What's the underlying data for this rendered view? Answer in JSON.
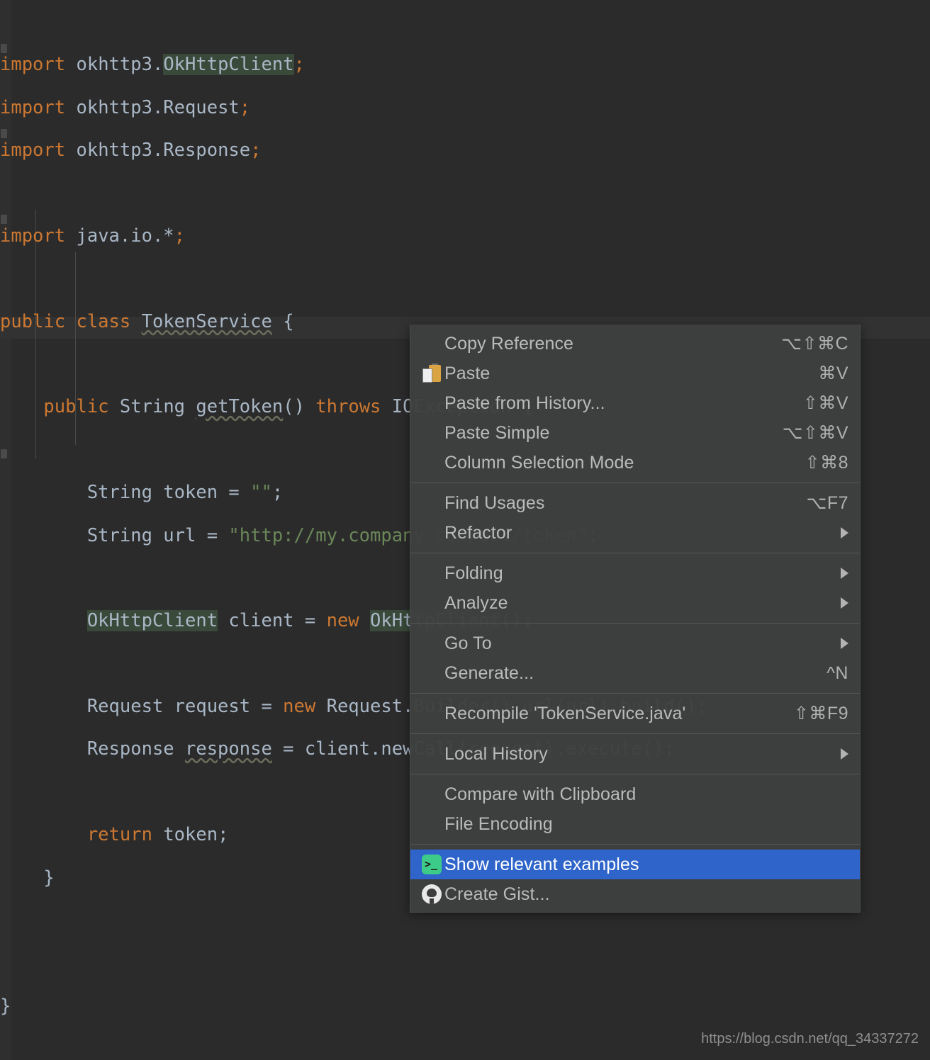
{
  "editor": {
    "background_color": "#2b2b2b",
    "gutter_color": "#2f2f2f",
    "current_line_color": "#323232",
    "usage_highlight_color": "#3a4a3a",
    "code_lines": [
      "import okhttp3.OkHttpClient;",
      "import okhttp3.Request;",
      "import okhttp3.Response;",
      "",
      "import java.io.*;",
      "",
      "public class TokenService {",
      "",
      "    public String getToken() throws IOException {",
      "",
      "        String token = \"\";",
      "        String url = \"http://my.company.com/api/token\";",
      "",
      "        OkHttpClient client = new OkHttpClient();",
      "",
      "        Request request = new Request.Builder().url(url).build();",
      "        Response response = client.newCall(request).execute();",
      "",
      "        return token;",
      "    }",
      "",
      "",
      "}"
    ],
    "class_name": "TokenService",
    "file_name": "TokenService.java",
    "method_name": "getToken",
    "url_literal": "http://my.company.com/api/token",
    "tokens": {
      "import": "import",
      "public": "public",
      "class": "class",
      "new": "new",
      "throws": "throws",
      "return": "return",
      "string_type": "String",
      "okhttp_client": "OkHttpClient",
      "request_type": "Request",
      "response_type": "Response",
      "io_exception": "IOException",
      "empty_string": "\"\"",
      "pkg_okhttp": "okhttp3.",
      "pkg_java_io": "java.io.*;"
    },
    "colors": {
      "keyword": "#cc7832",
      "string": "#6a8759",
      "text": "#a9b7c6"
    }
  },
  "context_menu": {
    "background_color": "#3e3f3f",
    "selected_color": "#2f65ca",
    "separator_color": "#555656",
    "groups": [
      {
        "items": [
          {
            "label": "Copy Reference",
            "shortcut": "⌥⇧⌘C",
            "icon": "",
            "arrow": false,
            "selected": false
          },
          {
            "label": "Paste",
            "shortcut": "⌘V",
            "icon": "clipboard-icon",
            "arrow": false,
            "selected": false
          },
          {
            "label": "Paste from History...",
            "shortcut": "⇧⌘V",
            "icon": "",
            "arrow": false,
            "selected": false
          },
          {
            "label": "Paste Simple",
            "shortcut": "⌥⇧⌘V",
            "icon": "",
            "arrow": false,
            "selected": false
          },
          {
            "label": "Column Selection Mode",
            "shortcut": "⇧⌘8",
            "icon": "",
            "arrow": false,
            "selected": false
          }
        ]
      },
      {
        "items": [
          {
            "label": "Find Usages",
            "shortcut": "⌥F7",
            "icon": "",
            "arrow": false,
            "selected": false
          },
          {
            "label": "Refactor",
            "shortcut": "",
            "icon": "",
            "arrow": true,
            "selected": false
          }
        ]
      },
      {
        "items": [
          {
            "label": "Folding",
            "shortcut": "",
            "icon": "",
            "arrow": true,
            "selected": false
          },
          {
            "label": "Analyze",
            "shortcut": "",
            "icon": "",
            "arrow": true,
            "selected": false
          }
        ]
      },
      {
        "items": [
          {
            "label": "Go To",
            "shortcut": "",
            "icon": "",
            "arrow": true,
            "selected": false
          },
          {
            "label": "Generate...",
            "shortcut": "^N",
            "icon": "",
            "arrow": false,
            "selected": false
          }
        ]
      },
      {
        "items": [
          {
            "label": "Recompile 'TokenService.java'",
            "shortcut": "⇧⌘F9",
            "icon": "",
            "arrow": false,
            "selected": false
          }
        ]
      },
      {
        "items": [
          {
            "label": "Local History",
            "shortcut": "",
            "icon": "",
            "arrow": true,
            "selected": false
          }
        ]
      },
      {
        "items": [
          {
            "label": "Compare with Clipboard",
            "shortcut": "",
            "icon": "",
            "arrow": false,
            "selected": false
          },
          {
            "label": "File Encoding",
            "shortcut": "",
            "icon": "",
            "arrow": false,
            "selected": false
          }
        ]
      },
      {
        "items": [
          {
            "label": "Show relevant examples",
            "shortcut": "",
            "icon": "terminal-icon",
            "arrow": false,
            "selected": true
          },
          {
            "label": "Create Gist...",
            "shortcut": "",
            "icon": "github-icon",
            "arrow": false,
            "selected": false
          }
        ]
      }
    ]
  },
  "watermark": {
    "text": "https://blog.csdn.net/qq_34337272"
  }
}
